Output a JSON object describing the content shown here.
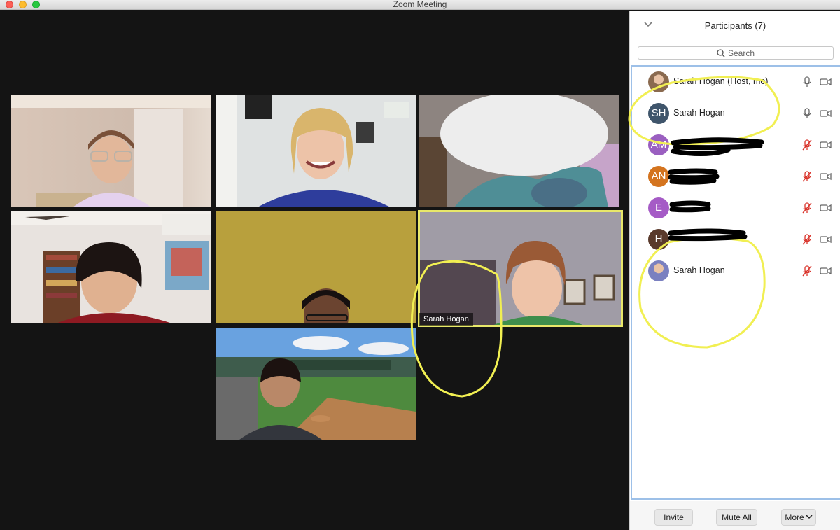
{
  "window": {
    "title": "Zoom Meeting"
  },
  "video": {
    "active_speaker_label": "Sarah Hogan"
  },
  "participants_panel": {
    "title": "Participants (7)",
    "search_placeholder": "Search",
    "participants": [
      {
        "name": "Sarah Hogan (Host, me)",
        "initials": "",
        "avatar_type": "photo",
        "avatar_color": "#8a6a4f",
        "mic": "on",
        "camera": "on"
      },
      {
        "name": "Sarah Hogan",
        "initials": "SH",
        "avatar_type": "initials",
        "avatar_color": "#3f556b",
        "mic": "on",
        "camera": "on"
      },
      {
        "name": "",
        "initials": "AM",
        "avatar_type": "initials",
        "avatar_color": "#9a5fc0",
        "mic": "muted",
        "camera": "on"
      },
      {
        "name": "",
        "initials": "AN",
        "avatar_type": "initials",
        "avatar_color": "#d4741f",
        "mic": "muted",
        "camera": "on"
      },
      {
        "name": "",
        "initials": "E",
        "avatar_type": "initials",
        "avatar_color": "#a55bc6",
        "mic": "muted",
        "camera": "on"
      },
      {
        "name": "",
        "initials": "H",
        "avatar_type": "initials",
        "avatar_color": "#5a3a2c",
        "mic": "muted",
        "camera": "on"
      },
      {
        "name": "Sarah Hogan",
        "initials": "",
        "avatar_type": "photo",
        "avatar_color": "#7a80c0",
        "mic": "muted",
        "camera": "on"
      }
    ],
    "footer": {
      "invite_label": "Invite",
      "mute_all_label": "Mute All",
      "more_label": "More"
    }
  },
  "colors": {
    "annotation": "#f1ef52",
    "active_speaker": "#e8e86a",
    "muted_mic": "#d9342b",
    "list_border": "#9dc0e8"
  }
}
